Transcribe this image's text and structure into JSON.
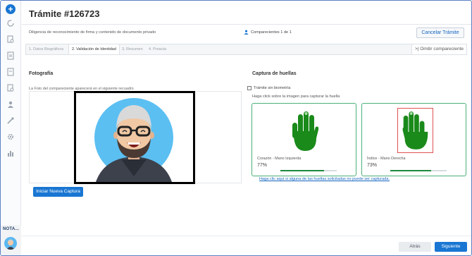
{
  "header": {
    "title": "Trámite #126723",
    "subtitle": "Diligencia de reconocimiento de firma y contenido de documento privado",
    "comparecientes": "Comparecientes 1 de 1",
    "cancel_label": "Cancelar Trámite"
  },
  "tabs": [
    {
      "label": "1. Datos Biográficos",
      "active": false
    },
    {
      "label": "2. Validación de Identidad",
      "active": true
    },
    {
      "label": "3. Resumen",
      "active": false
    },
    {
      "label": "4. Preacta",
      "active": false
    }
  ],
  "omit_label": ">| Omitir compareciente",
  "photo": {
    "title": "Fotografía",
    "caption": "La Foto del compareciente aparecerá en el siguiente recuadro",
    "capture_label": "Iniciar Nueva Captura"
  },
  "prints": {
    "title": "Captura de huellas",
    "no_biometric_label": "Trámite sin biometría",
    "hint": "Haga click sobre la imagen para capturar la huella",
    "cards": [
      {
        "label": "Corazón - Mano Izquierda",
        "percent": "77%",
        "progress": 0.77,
        "selected": false
      },
      {
        "label": "Índice - Mano Derecha",
        "percent": "73%",
        "progress": 0.73,
        "selected": true
      }
    ],
    "link": "Haga clic aquí si alguna de las huellas solicitadas no puede ser capturada."
  },
  "sidebar": {
    "nota_label": "NOTA...",
    "icons": [
      "home-icon",
      "refresh-icon",
      "document-search-icon",
      "document-icon",
      "document-icon",
      "document-search-icon",
      "user-icon",
      "tools-icon",
      "settings-icon",
      "chart-icon"
    ]
  },
  "footer": {
    "back_label": "Atrás",
    "next_label": "Siguiente"
  },
  "colors": {
    "primary": "#1976d2",
    "success": "#1e8a3d",
    "hand_green": "#1a8a1a",
    "card_border": "#4caf78",
    "selected_border": "#e05050"
  }
}
